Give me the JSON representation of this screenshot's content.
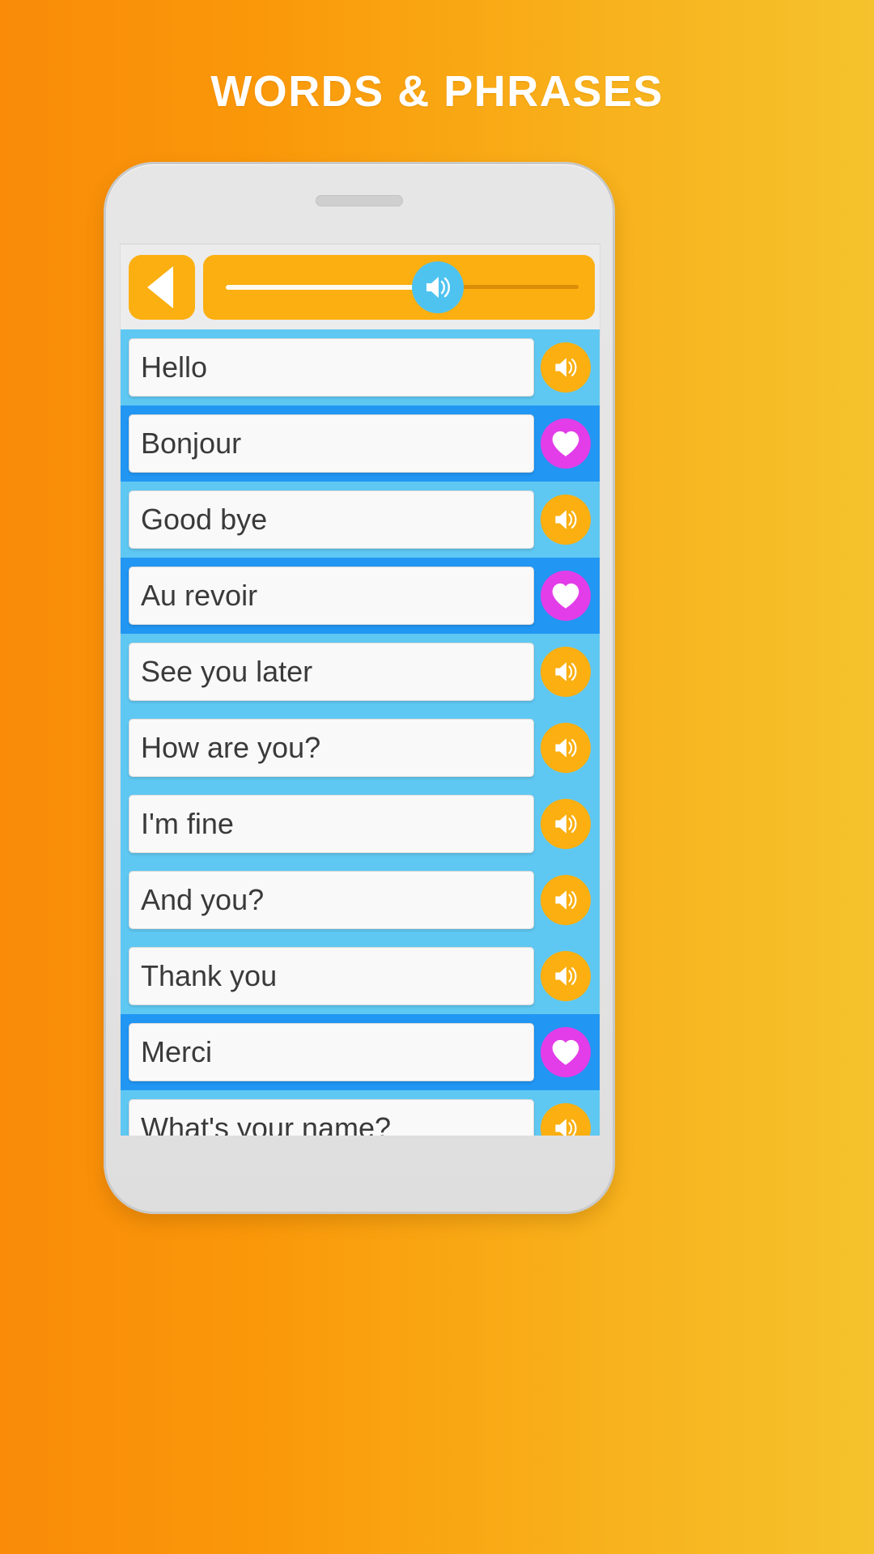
{
  "header": {
    "title": "WORDS & PHRASES"
  },
  "colors": {
    "background_left": "#F98B09",
    "background_right": "#F5C32D",
    "phone_body": "#E6E6E6",
    "toolbar_orange": "#FBAF10",
    "slider_thumb_cyan": "#4FC3F0",
    "row_english_blue": "#5FC8F2",
    "row_french_blue": "#2196F3",
    "speaker_button_orange": "#FBAF10",
    "favorite_button_magenta": "#E23DE8",
    "text_color": "#3A3A3A",
    "title_color": "#FFFFFF"
  },
  "phone": {
    "speaker_grille_name": "phone-speaker-grille"
  },
  "toolbar": {
    "back_icon": "back-triangle-icon",
    "slider": {
      "thumb_icon": "speaker-icon",
      "fill_percent": 50,
      "track_name": "volume-slider-track"
    }
  },
  "phrases": [
    {
      "text": "Hello",
      "lang": "en",
      "action": "speaker",
      "icon": "speaker-icon"
    },
    {
      "text": "Bonjour",
      "lang": "fr",
      "action": "favorite",
      "icon": "heart-icon"
    },
    {
      "text": "Good bye",
      "lang": "en",
      "action": "speaker",
      "icon": "speaker-icon"
    },
    {
      "text": "Au revoir",
      "lang": "fr",
      "action": "favorite",
      "icon": "heart-icon"
    },
    {
      "text": "See you later",
      "lang": "en",
      "action": "speaker",
      "icon": "speaker-icon"
    },
    {
      "text": "How are you?",
      "lang": "en",
      "action": "speaker",
      "icon": "speaker-icon"
    },
    {
      "text": "I'm fine",
      "lang": "en",
      "action": "speaker",
      "icon": "speaker-icon"
    },
    {
      "text": "And you?",
      "lang": "en",
      "action": "speaker",
      "icon": "speaker-icon"
    },
    {
      "text": "Thank you",
      "lang": "en",
      "action": "speaker",
      "icon": "speaker-icon"
    },
    {
      "text": "Merci",
      "lang": "fr",
      "action": "favorite",
      "icon": "heart-icon"
    },
    {
      "text": "What's your name?",
      "lang": "en",
      "action": "speaker",
      "icon": "speaker-icon"
    }
  ]
}
